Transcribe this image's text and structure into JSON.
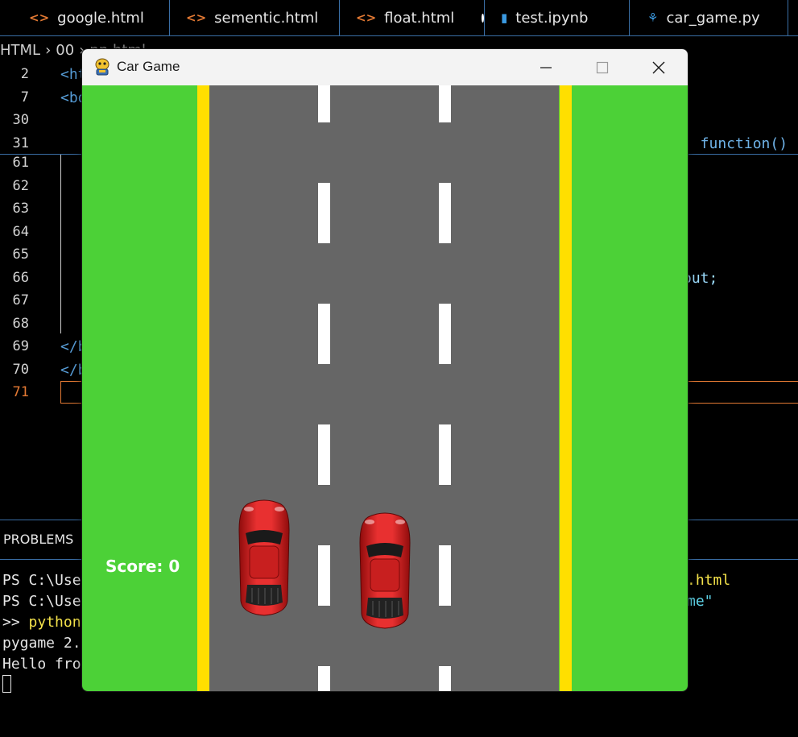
{
  "editor": {
    "tabs": [
      {
        "label": "google.html",
        "icon": "html-icon"
      },
      {
        "label": "sementic.html",
        "icon": "html-icon"
      },
      {
        "label": "float.html",
        "icon": "html-icon",
        "modified": true
      },
      {
        "label": "test.ipynb",
        "icon": "notebook-icon"
      },
      {
        "label": "car_game.py",
        "icon": "python-icon"
      }
    ],
    "breadcrumb": [
      "HTML",
      "00",
      "nn.html"
    ],
    "line_numbers": [
      "2",
      "7",
      "30",
      "31",
      "61",
      "62",
      "63",
      "64",
      "65",
      "66",
      "67",
      "68",
      "69",
      "70",
      "71"
    ],
    "active_line": "71",
    "code_left": [
      "<ht",
      "<bo",
      "</b",
      "</b"
    ],
    "code_right": {
      "line31": ", function()",
      "line66": "out;"
    },
    "accent_color": "#e37933"
  },
  "panel": {
    "title": "PROBLEMS",
    "terminal": [
      {
        "left": "PS C:\\Use",
        "right": ".html"
      },
      {
        "left": "PS C:\\Use",
        "right": "me\""
      },
      {
        "left": ">> python",
        "right": ""
      },
      {
        "left": "pygame 2.",
        "right": ""
      },
      {
        "left": "Hello fro",
        "right": ""
      }
    ]
  },
  "game_window": {
    "title": "Car Game",
    "icon": "pygame-snake-icon",
    "score_label": "Score: 0",
    "colors": {
      "grass": "#4cd137",
      "road": "#666666",
      "edge_line": "#ffdf00",
      "lane_marker": "#ffffff",
      "car": "#e02020"
    }
  }
}
